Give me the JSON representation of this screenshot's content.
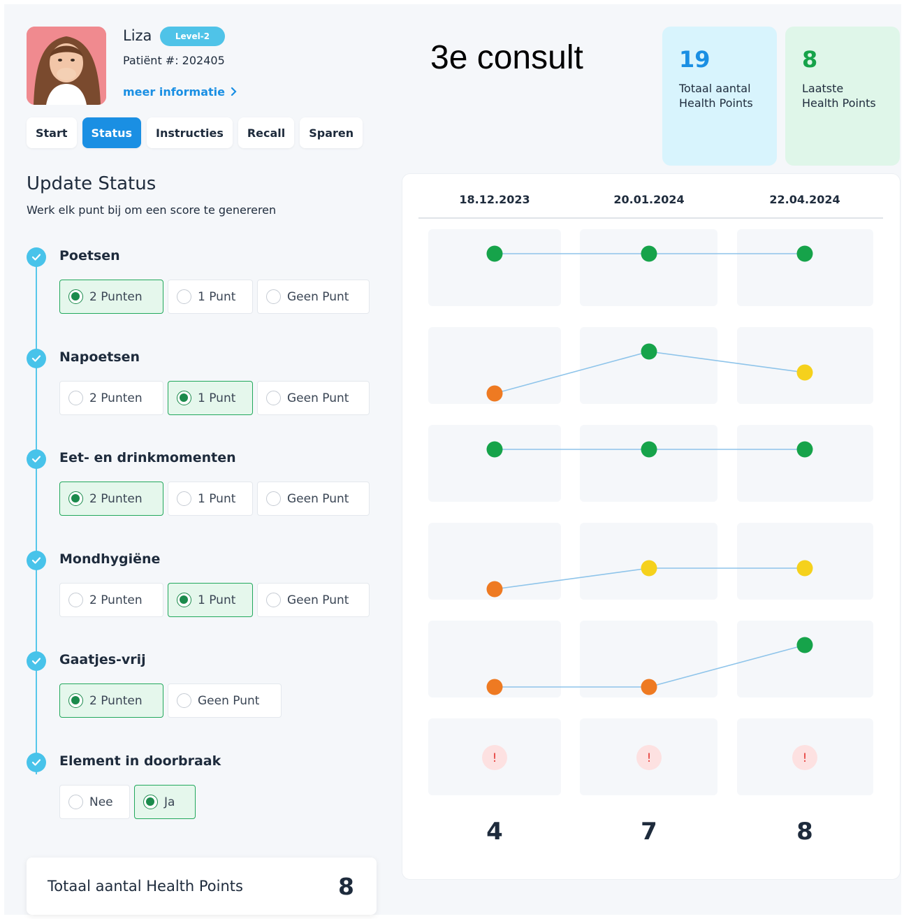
{
  "patient": {
    "name": "Liza",
    "level": "Level-2",
    "number_label": "Patiënt #: 202405",
    "more_info": "meer informatie"
  },
  "tabs": [
    "Start",
    "Status",
    "Instructies",
    "Recall",
    "Sparen"
  ],
  "active_tab": "Status",
  "consult_title": "3e consult",
  "stats": {
    "total": {
      "value": "19",
      "label_line1": "Totaal aantal",
      "label_line2": "Health Points"
    },
    "last": {
      "value": "8",
      "label_line1": "Laatste",
      "label_line2": "Health Points"
    }
  },
  "status": {
    "title": "Update Status",
    "subtitle": "Werk elk punt bij om een score te genereren",
    "items": [
      {
        "label": "Poetsen",
        "options": [
          "2 Punten",
          "1 Punt",
          "Geen Punt"
        ],
        "selected": 0
      },
      {
        "label": "Napoetsen",
        "options": [
          "2 Punten",
          "1 Punt",
          "Geen Punt"
        ],
        "selected": 1
      },
      {
        "label": "Eet- en drinkmomenten",
        "options": [
          "2 Punten",
          "1 Punt",
          "Geen Punt"
        ],
        "selected": 0
      },
      {
        "label": "Mondhygiëne",
        "options": [
          "2 Punten",
          "1 Punt",
          "Geen Punt"
        ],
        "selected": 1
      },
      {
        "label": "Gaatjes-vrij",
        "options": [
          "2 Punten",
          "Geen Punt"
        ],
        "selected": 0
      },
      {
        "label": "Element in doorbraak",
        "options": [
          "Nee",
          "Ja"
        ],
        "selected": 1
      }
    ]
  },
  "total_bar": {
    "label": "Totaal aantal Health Points",
    "value": "8"
  },
  "colors": {
    "accent": "#1a8fe3",
    "good": "#16a34a",
    "medium": "#f5d11c",
    "bad": "#ee7a22",
    "line": "#8ec4ea",
    "alert": "#e53935"
  },
  "icons": {
    "check": "check-icon",
    "chevron": "chevron-right-icon",
    "alert": "exclamation-icon"
  },
  "history": {
    "dates": [
      "18.12.2023",
      "20.01.2024",
      "22.04.2024"
    ],
    "scores": [
      "4",
      "7",
      "8"
    ],
    "rows": [
      {
        "item": "Poetsen",
        "points": [
          2,
          2,
          2
        ]
      },
      {
        "item": "Napoetsen",
        "points": [
          0,
          2,
          1
        ]
      },
      {
        "item": "Eet- en drinkmomenten",
        "points": [
          2,
          2,
          2
        ]
      },
      {
        "item": "Mondhygiëne",
        "points": [
          0,
          1,
          1
        ]
      },
      {
        "item": "Gaatjes-vrij",
        "points": [
          0,
          0,
          2
        ]
      }
    ],
    "alert_row": {
      "item": "Element in doorbraak",
      "symbol": "!",
      "flags": [
        true,
        true,
        true
      ]
    }
  }
}
